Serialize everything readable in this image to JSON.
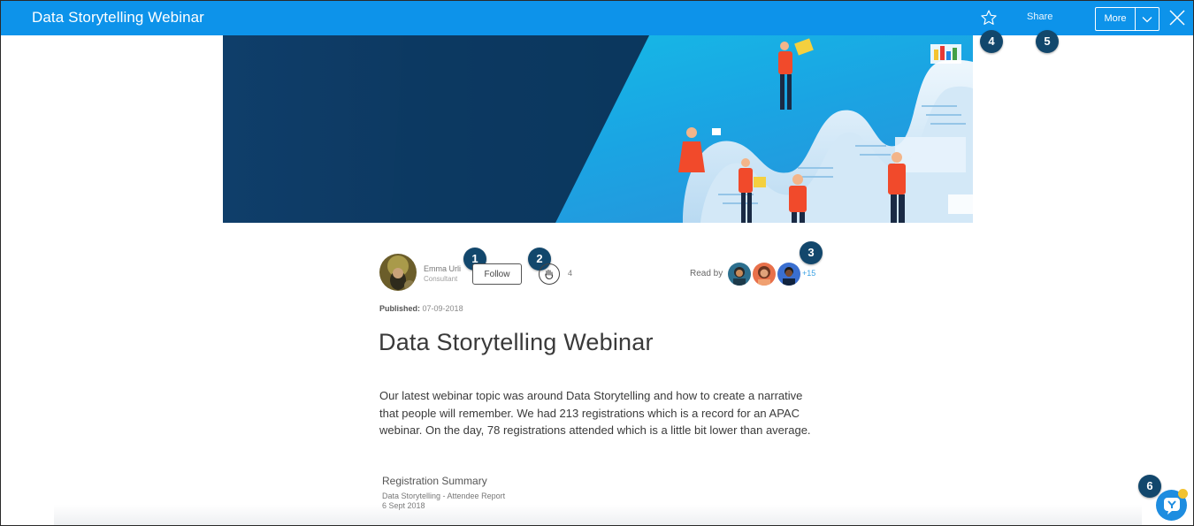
{
  "header": {
    "title": "Data Storytelling Webinar",
    "share_label": "Share",
    "more_label": "More"
  },
  "badges": [
    "1",
    "2",
    "3",
    "4",
    "5",
    "6"
  ],
  "author": {
    "name": "Emma Urli",
    "role": "Consultant",
    "follow_label": "Follow"
  },
  "claps": {
    "count": "4"
  },
  "readers": {
    "label": "Read by",
    "more": "+15"
  },
  "published": {
    "label": "Published:",
    "date": "07-09-2018"
  },
  "article": {
    "title": "Data Storytelling Webinar",
    "body": "Our latest webinar topic was around Data Storytelling and how to create a narrative that people will remember.  We had 213 registrations which is a record for an APAC webinar.  On the day, 78 registrations attended which is a little bit lower than average."
  },
  "registration": {
    "title": "Registration Summary",
    "subtitle": "Data Storytelling - Attendee Report",
    "date": "6 Sept 2018"
  },
  "colors": {
    "header_bg": "#0d93ea",
    "badge_bg": "#12476c",
    "accent_link": "#3aa1e4",
    "fab_bg": "#1e8de0"
  }
}
